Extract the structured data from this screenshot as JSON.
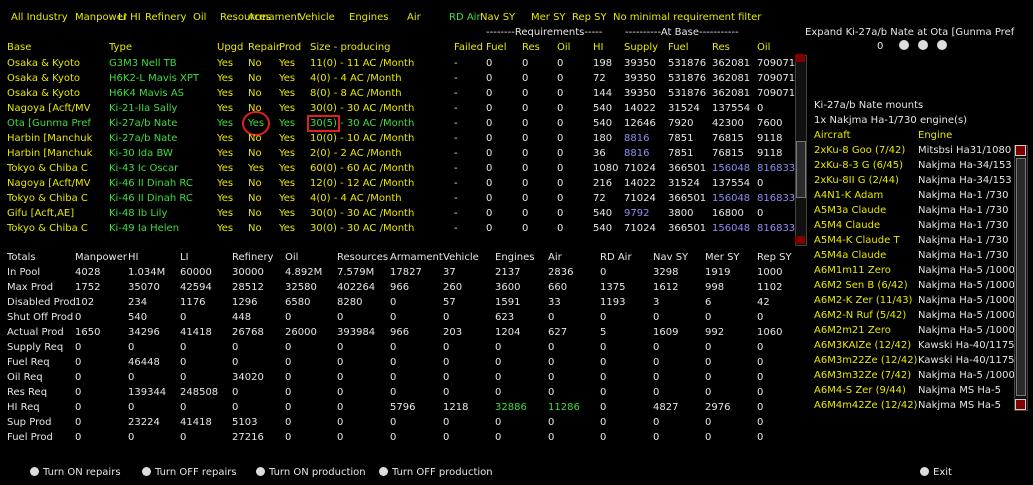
{
  "filters": [
    "All Industry",
    "Manpower HI",
    "LI",
    "Refinery",
    "Oil",
    "Resources",
    "Armament",
    "Vehicle",
    "Engines",
    "Air",
    "RD Air",
    "Nav SY",
    "Mer SY",
    "Rep SY",
    "No minimal requirement filter"
  ],
  "req_banner": "--------Requirements-----",
  "atbase_banner": "----------At Base-----------",
  "expand": {
    "title": "Expand Ki-27a/b Nate at Ota [Gunma Pref",
    "page": "0"
  },
  "headers": [
    "Base",
    "Type",
    "Upgd",
    "Repair",
    "Prod",
    "Size - producing",
    "Failed",
    "Fuel",
    "Res",
    "Oil",
    "HI",
    "Supply",
    "Fuel",
    "Res",
    "Oil"
  ],
  "rows": [
    {
      "base": "Osaka & Kyoto",
      "type": "G3M3 Nell TB",
      "upgd": "Yes",
      "repair": "No",
      "prod": "Yes",
      "size": "11(0) - 11 AC /Month",
      "failed": "-",
      "fuel": "0",
      "res": "0",
      "oil": "0",
      "hi": "198",
      "supply": "39350",
      "afuel": "531876",
      "ares": "362081",
      "aoil": "709071"
    },
    {
      "base": "Osaka & Kyoto",
      "type": "H6K2-L Mavis XPT",
      "upgd": "Yes",
      "repair": "No",
      "prod": "Yes",
      "size": "4(0) - 4 AC /Month",
      "failed": "-",
      "fuel": "0",
      "res": "0",
      "oil": "0",
      "hi": "72",
      "supply": "39350",
      "afuel": "531876",
      "ares": "362081",
      "aoil": "709071"
    },
    {
      "base": "Osaka & Kyoto",
      "type": "H6K4 Mavis AS",
      "upgd": "Yes",
      "repair": "No",
      "prod": "Yes",
      "size": "8(0) - 8 AC /Month",
      "failed": "-",
      "fuel": "0",
      "res": "0",
      "oil": "0",
      "hi": "144",
      "supply": "39350",
      "afuel": "531876",
      "ares": "362081",
      "aoil": "709071"
    },
    {
      "base": "Nagoya [Acft/MV",
      "type": "Ki-21-IIa Sally",
      "upgd": "Yes",
      "repair": "No",
      "prod": "Yes",
      "size": "30(0) - 30 AC /Month",
      "failed": "-",
      "fuel": "0",
      "res": "0",
      "oil": "0",
      "hi": "540",
      "supply": "14022",
      "afuel": "31524",
      "ares": "137554",
      "aoil": "0"
    },
    {
      "base": "Ota [Gunma Pref",
      "type": "Ki-27a/b Nate",
      "upgd": "Yes",
      "repair": "Yes",
      "prod": "Yes",
      "size_pre": "30(5)",
      "size": " - 30 AC /Month",
      "failed": "-",
      "fuel": "0",
      "res": "0",
      "oil": "0",
      "hi": "540",
      "supply": "12646",
      "afuel": "7920",
      "ares": "42300",
      "aoil": "7600",
      "selected": true
    },
    {
      "base": "Harbin [Manchuk",
      "type": "Ki-27a/b Nate",
      "upgd": "Yes",
      "repair": "No",
      "prod": "Yes",
      "size": "10(0) - 10 AC /Month",
      "failed": "-",
      "fuel": "0",
      "res": "0",
      "oil": "0",
      "hi": "180",
      "supply": "8816",
      "afuel": "7851",
      "ares": "76815",
      "aoil": "9118"
    },
    {
      "base": "Harbin [Manchuk",
      "type": "Ki-30 Ida BW",
      "upgd": "Yes",
      "repair": "No",
      "prod": "Yes",
      "size": "2(0) - 2 AC /Month",
      "failed": "-",
      "fuel": "0",
      "res": "0",
      "oil": "0",
      "hi": "36",
      "supply": "8816",
      "afuel": "7851",
      "ares": "76815",
      "aoil": "9118"
    },
    {
      "base": "Tokyo & Chiba C",
      "type": "Ki-43 Ic Oscar",
      "upgd": "Yes",
      "repair": "Yes",
      "prod": "Yes",
      "size": "60(0) - 60 AC /Month",
      "failed": "-",
      "fuel": "0",
      "res": "0",
      "oil": "0",
      "hi": "1080",
      "supply": "71024",
      "afuel": "366501",
      "ares": "156048",
      "aoil": "816833"
    },
    {
      "base": "Nagoya [Acft/MV",
      "type": "Ki-46 II Dinah RC",
      "upgd": "Yes",
      "repair": "No",
      "prod": "Yes",
      "size": "12(0) - 12 AC /Month",
      "failed": "-",
      "fuel": "0",
      "res": "0",
      "oil": "0",
      "hi": "216",
      "supply": "14022",
      "afuel": "31524",
      "ares": "137554",
      "aoil": "0"
    },
    {
      "base": "Tokyo & Chiba C",
      "type": "Ki-46 II Dinah RC",
      "upgd": "Yes",
      "repair": "No",
      "prod": "Yes",
      "size": "4(0) - 4 AC /Month",
      "failed": "-",
      "fuel": "0",
      "res": "0",
      "oil": "0",
      "hi": "72",
      "supply": "71024",
      "afuel": "366501",
      "ares": "156048",
      "aoil": "816833"
    },
    {
      "base": "Gifu [Acft,AE]",
      "type": "Ki-48 Ib Lily",
      "upgd": "Yes",
      "repair": "No",
      "prod": "Yes",
      "size": "30(0) - 30 AC /Month",
      "failed": "-",
      "fuel": "0",
      "res": "0",
      "oil": "0",
      "hi": "540",
      "supply": "9792",
      "afuel": "3800",
      "ares": "16800",
      "aoil": "0"
    },
    {
      "base": "Tokyo & Chiba C",
      "type": "Ki-49 Ia Helen",
      "upgd": "Yes",
      "repair": "No",
      "prod": "Yes",
      "size": "30(0) - 30 AC /Month",
      "failed": "-",
      "fuel": "0",
      "res": "0",
      "oil": "0",
      "hi": "540",
      "supply": "71024",
      "afuel": "366501",
      "ares": "156048",
      "aoil": "816833"
    }
  ],
  "side": {
    "title": "Ki-27a/b Nate mounts",
    "mount": "1x Nakjma Ha-1/730 engine(s)",
    "col_aircraft": "Aircraft",
    "col_engine": "Engine",
    "items": [
      [
        "2xKu-8 Goo (7/42)",
        "Mitsbsi Ha31/1080"
      ],
      [
        "2xKu-8-3 G (6/45)",
        "Nakjma Ha-34/153"
      ],
      [
        "2xKu-8II G (2/44)",
        "Nakjma Ha-34/153"
      ],
      [
        "A4N1-K Adam",
        "Nakjma Ha-1 /730"
      ],
      [
        "A5M3a Claude",
        "Nakjma Ha-1 /730"
      ],
      [
        "A5M4 Claude",
        "Nakjma Ha-1 /730"
      ],
      [
        "A5M4-K Claude T",
        "Nakjma Ha-1 /730"
      ],
      [
        "A5M4a Claude",
        "Nakjma Ha-1 /730"
      ],
      [
        "A6M1m11 Zero",
        "Nakjma Ha-5 /1000"
      ],
      [
        "A6M2 Sen B (6/42)",
        "Nakjma Ha-5 /1000"
      ],
      [
        "A6M2-K Zer (11/43)",
        "Nakjma Ha-5 /1000"
      ],
      [
        "A6M2-N Ruf (5/42)",
        "Nakjma Ha-5 /1000"
      ],
      [
        "A6M2m21 Zero",
        "Nakjma Ha-5 /1000"
      ],
      [
        "A6M3KAIZe (12/42)",
        "Kawski Ha-40/1175"
      ],
      [
        "A6M3m22Ze (12/42)",
        "Kawski Ha-40/1175"
      ],
      [
        "A6M3m32Ze (7/42)",
        "Nakjma Ha-5 /1000"
      ],
      [
        "A6M4-S Zer (9/44)",
        "Nakjma MS Ha-5"
      ],
      [
        "A6M4m42Ze (12/42)",
        "Nakjma MS Ha-5"
      ]
    ]
  },
  "totals": {
    "headers": [
      "Totals",
      "Manpower",
      "HI",
      "LI",
      "Refinery",
      "Oil",
      "Resources",
      "Armament",
      "Vehicle",
      "Engines",
      "Air",
      "RD Air",
      "Nav SY",
      "Mer SY",
      "Rep SY"
    ],
    "rows": [
      [
        "In Pool",
        "4028",
        "1.034M",
        "60000",
        "30000",
        "4.892M",
        "7.579M",
        "17827",
        "37",
        "2137",
        "2836",
        "0",
        "3298",
        "1919",
        "1000"
      ],
      [
        "Max Prod",
        "1752",
        "35070",
        "42594",
        "28512",
        "32580",
        "402264",
        "966",
        "260",
        "3600",
        "660",
        "1375",
        "1612",
        "998",
        "1102"
      ],
      [
        "Disabled Prod",
        "102",
        "234",
        "1176",
        "1296",
        "6580",
        "8280",
        "0",
        "57",
        "1591",
        "33",
        "1193",
        "3",
        "6",
        "42"
      ],
      [
        "Shut Off Prod",
        "0",
        "540",
        "0",
        "448",
        "0",
        "0",
        "0",
        "0",
        "623",
        "0",
        "0",
        "0",
        "0",
        "0"
      ],
      [
        "Actual Prod",
        "1650",
        "34296",
        "41418",
        "26768",
        "26000",
        "393984",
        "966",
        "203",
        "1204",
        "627",
        "5",
        "1609",
        "992",
        "1060"
      ],
      [
        "Supply Req",
        "0",
        "0",
        "0",
        "0",
        "0",
        "0",
        "0",
        "0",
        "0",
        "0",
        "0",
        "0",
        "0",
        "0"
      ],
      [
        "Fuel Req",
        "0",
        "46448",
        "0",
        "0",
        "0",
        "0",
        "0",
        "0",
        "0",
        "0",
        "0",
        "0",
        "0",
        "0"
      ],
      [
        "Oil Req",
        "0",
        "0",
        "0",
        "34020",
        "0",
        "0",
        "0",
        "0",
        "0",
        "0",
        "0",
        "0",
        "0",
        "0"
      ],
      [
        "Res Req",
        "0",
        "139344",
        "248508",
        "0",
        "0",
        "0",
        "0",
        "0",
        "0",
        "0",
        "0",
        "0",
        "0",
        "0"
      ],
      [
        "HI Req",
        "0",
        "0",
        "0",
        "0",
        "0",
        "0",
        "5796",
        "1218",
        "32886",
        "11286",
        "0",
        "4827",
        "2976",
        "0"
      ],
      [
        "Sup Prod",
        "0",
        "23224",
        "41418",
        "5103",
        "0",
        "0",
        "0",
        "0",
        "0",
        "0",
        "0",
        "0",
        "0",
        "0"
      ],
      [
        "Fuel Prod",
        "0",
        "0",
        "0",
        "27216",
        "0",
        "0",
        "0",
        "0",
        "0",
        "0",
        "0",
        "0",
        "0",
        "0"
      ]
    ]
  },
  "buttons": {
    "on_repairs": "Turn ON repairs",
    "off_repairs": "Turn OFF repairs",
    "on_prod": "Turn ON production",
    "off_prod": "Turn OFF production",
    "exit": "Exit"
  }
}
